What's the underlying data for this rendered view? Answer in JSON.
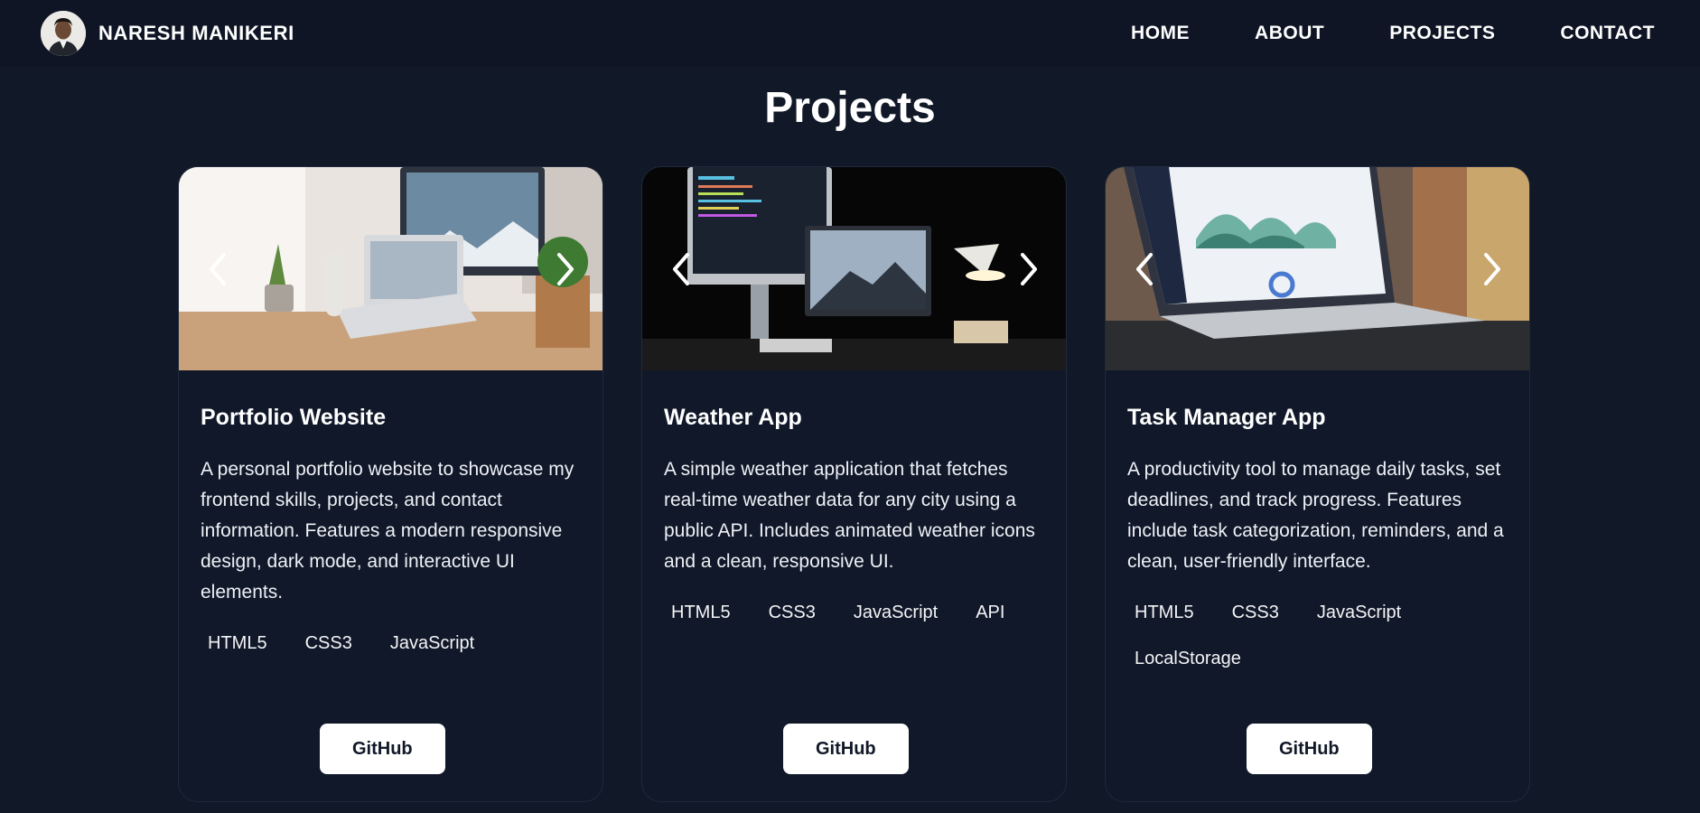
{
  "nav": {
    "brand": "NARESH MANIKERI",
    "links": [
      "HOME",
      "ABOUT",
      "PROJECTS",
      "CONTACT"
    ]
  },
  "page": {
    "title": "Projects"
  },
  "projects": [
    {
      "title": "Portfolio Website",
      "description": "A personal portfolio website to showcase my frontend skills, projects, and contact information. Features a modern responsive design, dark mode, and interactive UI elements.",
      "tags": [
        "HTML5",
        "CSS3",
        "JavaScript"
      ],
      "button": "GitHub"
    },
    {
      "title": "Weather App",
      "description": "A simple weather application that fetches real-time weather data for any city using a public API. Includes animated weather icons and a clean, responsive UI.",
      "tags": [
        "HTML5",
        "CSS3",
        "JavaScript",
        "API"
      ],
      "button": "GitHub"
    },
    {
      "title": "Task Manager App",
      "description": "A productivity tool to manage daily tasks, set deadlines, and track progress. Features include task categorization, reminders, and a clean, user-friendly interface.",
      "tags": [
        "HTML5",
        "CSS3",
        "JavaScript",
        "LocalStorage"
      ],
      "button": "GitHub"
    }
  ],
  "icons": {
    "prev": "chevron-left-icon",
    "next": "chevron-right-icon"
  },
  "colors": {
    "background": "#111827",
    "navbar": "#0f1524",
    "card": "#101829",
    "button_bg": "#ffffff",
    "button_text": "#111827"
  }
}
